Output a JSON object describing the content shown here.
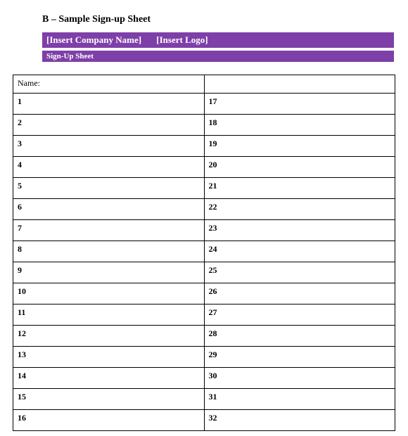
{
  "title": "B – Sample Sign-up Sheet",
  "company_bar": {
    "company": "[Insert Company Name]",
    "logo": "[Insert Logo]"
  },
  "subtitle_bar": "Sign-Up Sheet",
  "table": {
    "header_left": "Name:",
    "header_right": "",
    "rows": [
      {
        "left": "1",
        "right": "17"
      },
      {
        "left": "2",
        "right": "18"
      },
      {
        "left": "3",
        "right": "19"
      },
      {
        "left": "4",
        "right": "20"
      },
      {
        "left": "5",
        "right": "21"
      },
      {
        "left": "6",
        "right": "22"
      },
      {
        "left": "7",
        "right": "23"
      },
      {
        "left": "8",
        "right": "24"
      },
      {
        "left": "9",
        "right": "25"
      },
      {
        "left": "10",
        "right": "26"
      },
      {
        "left": "11",
        "right": "27"
      },
      {
        "left": "12",
        "right": "28"
      },
      {
        "left": "13",
        "right": "29"
      },
      {
        "left": "14",
        "right": "30"
      },
      {
        "left": "15",
        "right": "31"
      },
      {
        "left": "16",
        "right": "32"
      }
    ]
  }
}
